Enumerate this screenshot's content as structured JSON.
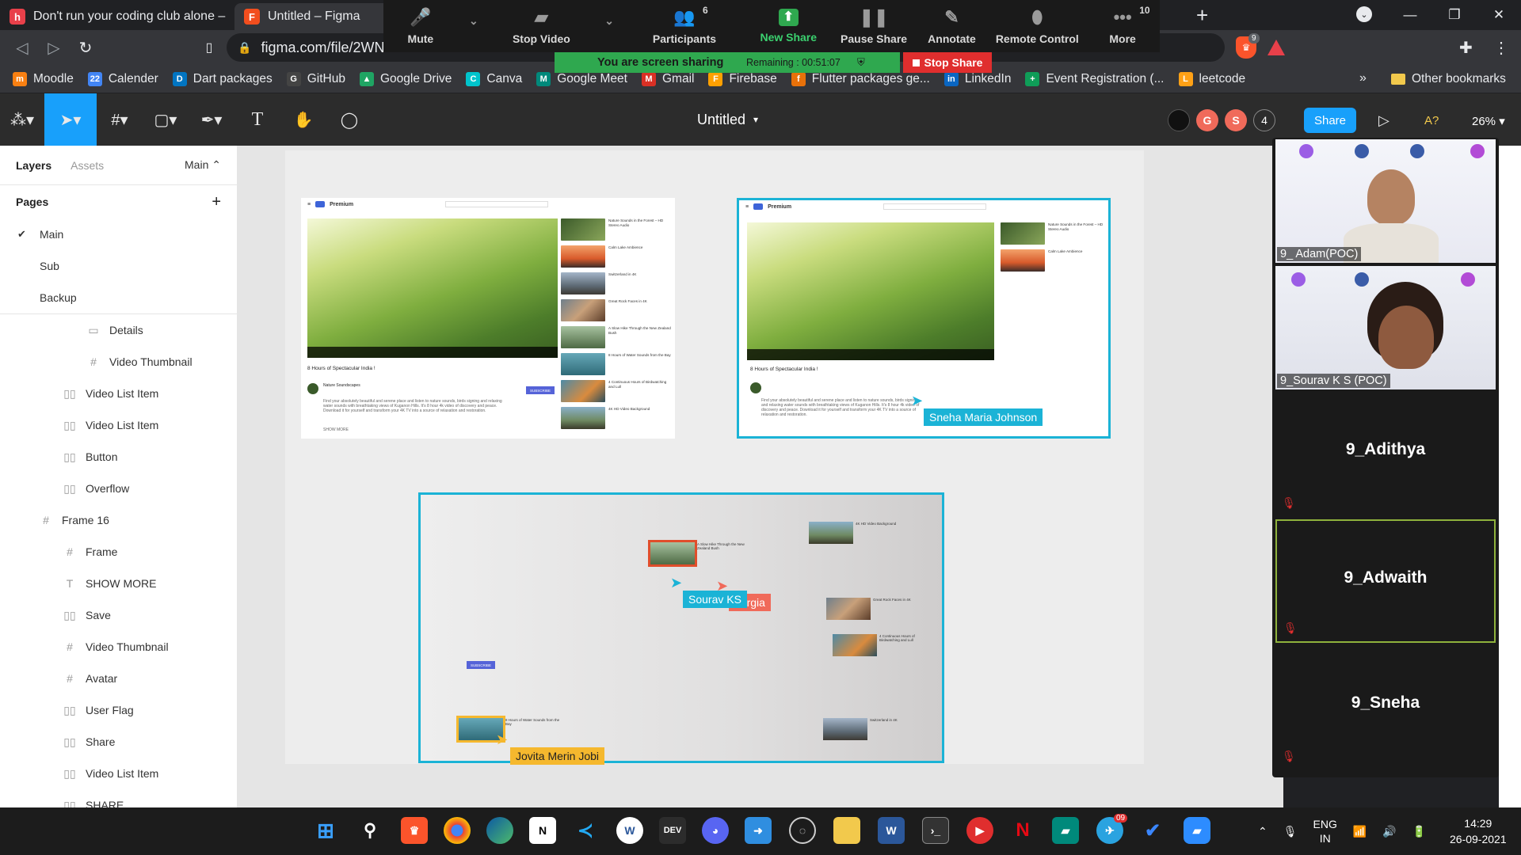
{
  "browser": {
    "tabs": [
      {
        "title": "Don't run your coding club alone – Ha",
        "favicon": "h",
        "color": "#e8404a"
      },
      {
        "title": "Untitled – Figma",
        "favicon": "F",
        "color": "#f24e1e"
      }
    ],
    "url": "figma.com/file/2WN",
    "brave_badge": "9",
    "bookmarks": [
      {
        "label": "Moodle",
        "icon": "moodle-icon",
        "color": "#f98012",
        "glyph": "m"
      },
      {
        "label": "Calender",
        "icon": "calendar-icon",
        "color": "#4285f4",
        "glyph": "22"
      },
      {
        "label": "Dart packages",
        "icon": "dart-icon",
        "color": "#0175c2",
        "glyph": "D"
      },
      {
        "label": "GitHub",
        "icon": "github-icon",
        "color": "#444",
        "glyph": "G"
      },
      {
        "label": "Google Drive",
        "icon": "drive-icon",
        "color": "#1fa463",
        "glyph": "▲"
      },
      {
        "label": "Canva",
        "icon": "canva-icon",
        "color": "#00c4cc",
        "glyph": "C"
      },
      {
        "label": "Google Meet",
        "icon": "meet-icon",
        "color": "#00897b",
        "glyph": "M"
      },
      {
        "label": "Gmail",
        "icon": "gmail-icon",
        "color": "#d93025",
        "glyph": "M"
      },
      {
        "label": "Firebase",
        "icon": "firebase-icon",
        "color": "#ffa000",
        "glyph": "F"
      },
      {
        "label": "Flutter packages ge...",
        "icon": "flutter-icon",
        "color": "#e8710a",
        "glyph": "f"
      },
      {
        "label": "LinkedIn",
        "icon": "linkedin-icon",
        "color": "#0a66c2",
        "glyph": "in"
      },
      {
        "label": "Event Registration (...",
        "icon": "forms-icon",
        "color": "#0f9d58",
        "glyph": "+"
      },
      {
        "label": "leetcode",
        "icon": "leetcode-icon",
        "color": "#ffa116",
        "glyph": "L"
      }
    ],
    "bookmarks_more": "»",
    "other_bookmarks": "Other bookmarks"
  },
  "zoom": {
    "toolbar": [
      {
        "label": "Mute",
        "icon": "microphone-icon",
        "glyph": "🎤",
        "w": 100,
        "caret": true
      },
      {
        "label": "Stop Video",
        "icon": "video-camera-icon",
        "glyph": "▰",
        "w": 140,
        "caret": true
      },
      {
        "label": "Participants",
        "icon": "participants-icon",
        "glyph": "👥",
        "w": 160,
        "count": "6"
      },
      {
        "label": "New Share",
        "icon": "new-share-icon",
        "glyph": "⬆",
        "w": 120,
        "green": true
      },
      {
        "label": "Pause Share",
        "icon": "pause-icon",
        "glyph": "❚❚",
        "w": 110
      },
      {
        "label": "Annotate",
        "icon": "pen-icon",
        "glyph": "✎",
        "w": 100
      },
      {
        "label": "Remote Control",
        "icon": "mouse-icon",
        "glyph": "⬮",
        "w": 130
      },
      {
        "label": "More",
        "icon": "more-icon",
        "glyph": "•••",
        "w": 100,
        "count": "10"
      }
    ],
    "sharing_text": "You are screen sharing",
    "remaining": "Remaining : 00:51:07",
    "stop_share": "Stop Share",
    "participants": [
      {
        "name": "9_ Adam(POC)",
        "type": "video"
      },
      {
        "name": "9_Sourav K S (POC)",
        "type": "video"
      },
      {
        "name": "9_Adithya",
        "type": "muted"
      },
      {
        "name": "9_Adwaith",
        "type": "muted"
      },
      {
        "name": "9_Sneha",
        "type": "muted"
      }
    ]
  },
  "figma": {
    "file_title": "Untitled",
    "zoom_level": "26%",
    "share_label": "Share",
    "a2_label": "A?",
    "avatars": [
      {
        "label": "",
        "color": "#222"
      },
      {
        "label": "G",
        "color": "#f06a5a"
      },
      {
        "label": "S",
        "color": "#f06a5a"
      },
      {
        "label": "4",
        "color": "#2c2c2c"
      }
    ],
    "panel_tabs": {
      "layers": "Layers",
      "assets": "Assets",
      "page_select": "Main"
    },
    "pages_header": "Pages",
    "pages": [
      "Main",
      "Sub",
      "Backup"
    ],
    "layers": [
      {
        "label": "Details",
        "icon": "component-icon",
        "glyph": "▭",
        "indent": 110
      },
      {
        "label": "Video Thumbnail",
        "icon": "frame-icon",
        "glyph": "#",
        "indent": 110
      },
      {
        "label": "Video List Item",
        "icon": "component-icon",
        "glyph": "▯▯",
        "indent": 80
      },
      {
        "label": "Video List Item",
        "icon": "component-icon",
        "glyph": "▯▯",
        "indent": 80
      },
      {
        "label": "Button",
        "icon": "component-icon",
        "glyph": "▯▯",
        "indent": 80
      },
      {
        "label": "Overflow",
        "icon": "component-icon",
        "glyph": "▯▯",
        "indent": 80
      },
      {
        "label": "Frame 16",
        "icon": "frame-icon",
        "glyph": "#",
        "indent": 50
      },
      {
        "label": "Frame",
        "icon": "frame-icon",
        "glyph": "#",
        "indent": 80
      },
      {
        "label": "SHOW MORE",
        "icon": "text-icon",
        "glyph": "T",
        "indent": 80
      },
      {
        "label": "Save",
        "icon": "component-icon",
        "glyph": "▯▯",
        "indent": 80
      },
      {
        "label": "Video Thumbnail",
        "icon": "frame-icon",
        "glyph": "#",
        "indent": 80
      },
      {
        "label": "Avatar",
        "icon": "frame-icon",
        "glyph": "#",
        "indent": 80
      },
      {
        "label": "User Flag",
        "icon": "component-icon",
        "glyph": "▯▯",
        "indent": 80
      },
      {
        "label": "Share",
        "icon": "component-icon",
        "glyph": "▯▯",
        "indent": 80
      },
      {
        "label": "Video List Item",
        "icon": "component-icon",
        "glyph": "▯▯",
        "indent": 80
      },
      {
        "label": "SHARE",
        "icon": "component-icon",
        "glyph": "▯▯",
        "indent": 80
      }
    ],
    "video_title": "8 Hours of Spectacular India !",
    "video_title_2": "8 Hours of Spectacular India !",
    "subscribe": "SUBSCRIBE",
    "channel": "Nature Soundscapes",
    "description": "Find your absolutely beautiful and serene place and listen to nature sounds, birds signing and relaxing water sounds with breathtaking views of Kuganon Hills. It's 8 hour 4k video of discovery and peace. Download it for yourself and transform your 4K TV into a source of relaxation and restoration.",
    "show_more": "SHOW MORE",
    "premium": "Premium",
    "thumbnails": [
      {
        "title": "Nature Sounds in the Forest – HD Stereo Audio",
        "cls": "g1"
      },
      {
        "title": "Calm Lake Ambience",
        "cls": "g2"
      },
      {
        "title": "Switzerland in 4K",
        "cls": "g3"
      },
      {
        "title": "Great Rock Faces in 4K",
        "cls": "g4"
      },
      {
        "title": "A Slow Hike Through the New Zealand Bush",
        "cls": "g5"
      },
      {
        "title": "8 Hours of Water Sounds from the Bay",
        "cls": "g6"
      },
      {
        "title": "4 Continuous Hours of Birdwatching and Lull",
        "cls": "g7"
      },
      {
        "title": "4K HD Video Background",
        "cls": "g8"
      }
    ],
    "cursors": [
      {
        "name": "Sneha Maria Johnson",
        "color": "#1bb3d6"
      },
      {
        "name": "Sourav KS",
        "color": "#1bb3d6"
      },
      {
        "name": "eorgia",
        "color": "#f06a5a"
      },
      {
        "name": "Jovita Merin Jobi",
        "color": "#f5b82e"
      }
    ]
  },
  "taskbar": {
    "lang": "ENG",
    "region": "IN",
    "time": "14:29",
    "date": "26-09-2021",
    "telegram_badge": "09"
  }
}
